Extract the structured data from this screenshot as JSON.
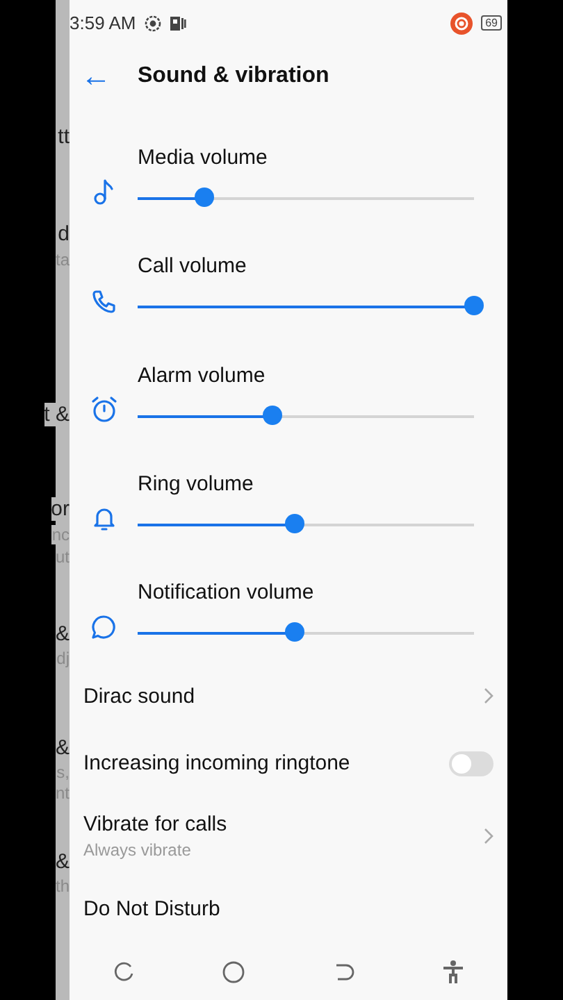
{
  "status_bar": {
    "time": "3:59 AM",
    "battery": "69"
  },
  "background_fragments": [
    "tt",
    "d",
    "ta",
    "t &",
    "or",
    "nc",
    "ut",
    "&",
    "dj",
    "&",
    "s,",
    "nt",
    "&",
    "th"
  ],
  "header": {
    "back": "←",
    "title": "Sound & vibration"
  },
  "volumes": [
    {
      "kind": "music",
      "label": "Media volume",
      "level": 0.2
    },
    {
      "kind": "phone",
      "label": "Call volume",
      "level": 1.0
    },
    {
      "kind": "alarm",
      "label": "Alarm volume",
      "level": 0.4
    },
    {
      "kind": "bell",
      "label": "Ring volume",
      "level": 0.465
    },
    {
      "kind": "chat",
      "label": "Notification volume",
      "level": 0.465
    }
  ],
  "settings": [
    {
      "kind": "link",
      "title": "Dirac sound"
    },
    {
      "kind": "toggle",
      "title": "Increasing incoming ringtone",
      "on": false
    },
    {
      "kind": "link",
      "title": "Vibrate for calls",
      "subtitle": "Always vibrate"
    },
    {
      "kind": "link",
      "title": "Do Not Disturb"
    }
  ]
}
